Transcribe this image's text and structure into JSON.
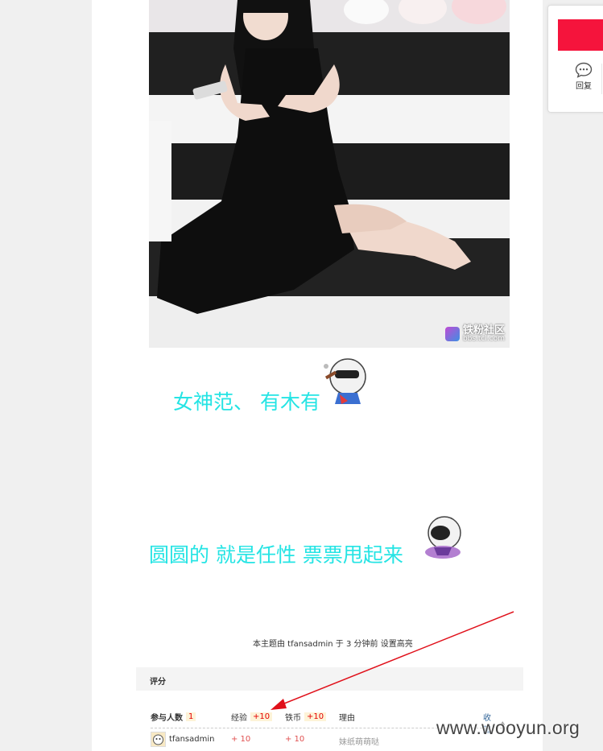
{
  "post": {
    "photo": {
      "watermark_title": "铁粉社区",
      "watermark_url": "bbs.tcl.com"
    },
    "caption_1": "女神范、 有木有",
    "caption_2": "圆圆的 就是任性  票票甩起来",
    "emoji_1": "smoking-mascot-icon",
    "emoji_2": "hug-mascot-icon"
  },
  "highlight_note": "本主题由 tfansadmin 于 3 分钟前 设置高亮",
  "rating": {
    "title": "评分",
    "participants_label": "参与人数",
    "participants_count": "1",
    "exp_label": "经验",
    "exp_total": "+10",
    "coin_label": "铁币",
    "coin_total": "+10",
    "reason_label": "理由",
    "collapse_label": "收起",
    "rows": [
      {
        "user": "tfansadmin",
        "exp": "+ 10",
        "coin": "+ 10",
        "reason": "妹纸萌萌哒"
      }
    ]
  },
  "side_panel": {
    "accent_color": "#f5143c",
    "reply_label": "回复",
    "reply_icon": "speech-bubble-icon"
  },
  "watermark": "www.wooyun.org",
  "colors": {
    "caption": "#25e4e4",
    "annotation_arrow": "#e0101a"
  }
}
